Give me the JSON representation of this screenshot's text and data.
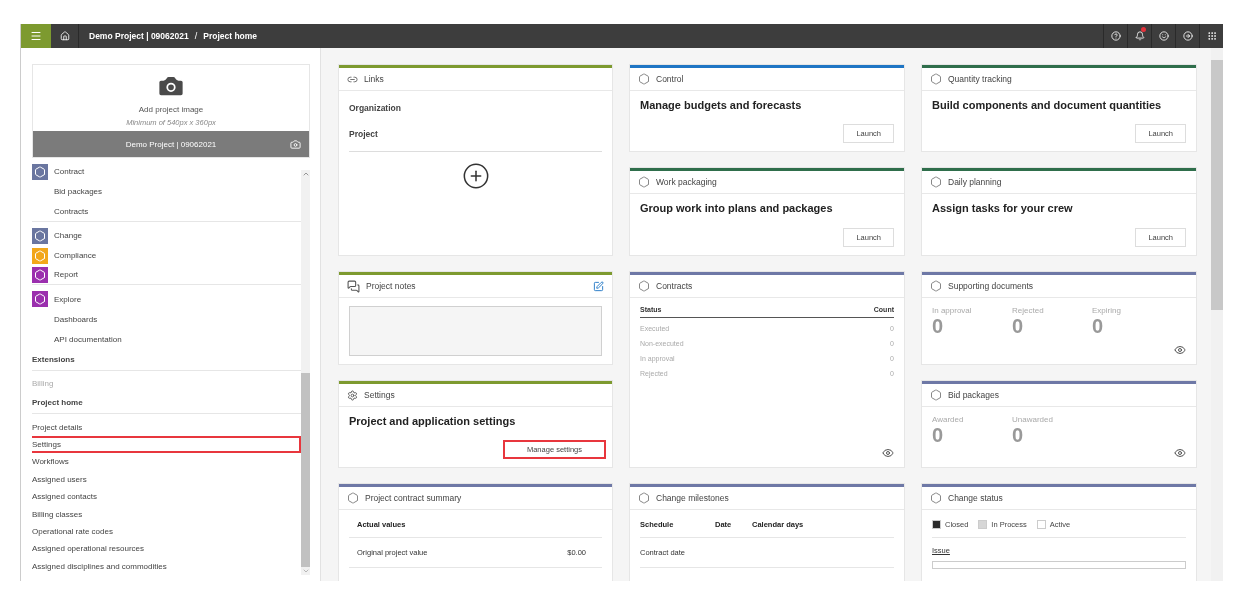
{
  "topbar": {
    "separator": "/",
    "breadcrumb": [
      {
        "label": "Demo Project | 09062021"
      },
      {
        "label": "Project home"
      }
    ],
    "notification_badge": true
  },
  "sidebar": {
    "image_panel": {
      "title": "Add project image",
      "hint": "Minimum of 540px x 360px",
      "project_name": "Demo Project | 09062021"
    },
    "items": [
      {
        "kind": "app",
        "label": "Contract",
        "color": "#6a76a0",
        "divider": false,
        "disabled": false,
        "highlighted": false
      },
      {
        "kind": "sub",
        "label": "Bid packages",
        "divider": false,
        "disabled": false,
        "highlighted": false
      },
      {
        "kind": "sub",
        "label": "Contracts",
        "divider": true,
        "disabled": false,
        "highlighted": false
      },
      {
        "kind": "app",
        "label": "Change",
        "color": "#6a76a0",
        "divider": false,
        "disabled": false,
        "highlighted": false
      },
      {
        "kind": "app",
        "label": "Compliance",
        "color": "#f2a71b",
        "divider": false,
        "disabled": false,
        "highlighted": false
      },
      {
        "kind": "app",
        "label": "Report",
        "color": "#9b2fae",
        "divider": true,
        "disabled": false,
        "highlighted": false
      },
      {
        "kind": "app",
        "label": "Explore",
        "color": "#9b2fae",
        "divider": false,
        "disabled": false,
        "highlighted": false
      },
      {
        "kind": "sub",
        "label": "Dashboards",
        "divider": false,
        "disabled": false,
        "highlighted": false
      },
      {
        "kind": "sub",
        "label": "API documentation",
        "divider": false,
        "disabled": false,
        "highlighted": false
      },
      {
        "kind": "heading",
        "label": "Extensions",
        "divider": true,
        "disabled": false,
        "highlighted": false
      },
      {
        "kind": "plain",
        "label": "Billing",
        "divider": false,
        "disabled": true,
        "highlighted": false
      },
      {
        "kind": "heading",
        "label": "Project home",
        "divider": true,
        "disabled": false,
        "highlighted": false
      },
      {
        "kind": "plain",
        "label": "Project details",
        "divider": false,
        "disabled": false,
        "highlighted": false
      },
      {
        "kind": "plain",
        "label": "Settings",
        "divider": false,
        "disabled": false,
        "highlighted": true
      },
      {
        "kind": "plain",
        "label": "Workflows",
        "divider": false,
        "disabled": false,
        "highlighted": false
      },
      {
        "kind": "plain",
        "label": "Assigned users",
        "divider": false,
        "disabled": false,
        "highlighted": false
      },
      {
        "kind": "plain",
        "label": "Assigned contacts",
        "divider": false,
        "disabled": false,
        "highlighted": false
      },
      {
        "kind": "plain",
        "label": "Billing classes",
        "divider": false,
        "disabled": false,
        "highlighted": false
      },
      {
        "kind": "plain",
        "label": "Operational rate codes",
        "divider": false,
        "disabled": false,
        "highlighted": false
      },
      {
        "kind": "plain",
        "label": "Assigned operational resources",
        "divider": false,
        "disabled": false,
        "highlighted": false
      },
      {
        "kind": "plain",
        "label": "Assigned disciplines and commodities",
        "divider": false,
        "disabled": false,
        "highlighted": false
      }
    ]
  },
  "cards": [
    {
      "kind": "links",
      "title": "Links",
      "color": "#7d9a2f",
      "rows": [
        "Organization",
        "Project"
      ]
    },
    {
      "kind": "launch",
      "title": "Control",
      "color": "#1f75c4",
      "heading": "Manage budgets and forecasts",
      "button": "Launch"
    },
    {
      "kind": "launch",
      "title": "Quantity tracking",
      "color": "#2f6e4b",
      "heading": "Build components and document quantities",
      "button": "Launch"
    },
    {
      "kind": "launch",
      "title": "Work packaging",
      "color": "#2f6e4b",
      "heading": "Group work into plans and packages",
      "button": "Launch"
    },
    {
      "kind": "launch",
      "title": "Daily planning",
      "color": "#2f6e4b",
      "heading": "Assign tasks for your crew",
      "button": "Launch"
    },
    {
      "kind": "notes",
      "title": "Project notes",
      "color": "#7d9a2f"
    },
    {
      "kind": "table",
      "title": "Contracts",
      "color": "#6e78a6",
      "columns": [
        "Status",
        "Count"
      ],
      "rows": [
        [
          "Executed",
          "0"
        ],
        [
          "Non-executed",
          "0"
        ],
        [
          "In approval",
          "0"
        ],
        [
          "Rejected",
          "0"
        ]
      ]
    },
    {
      "kind": "stats",
      "title": "Supporting documents",
      "color": "#6e78a6",
      "stats": [
        {
          "label": "In approval",
          "value": "0"
        },
        {
          "label": "Rejected",
          "value": "0"
        },
        {
          "label": "Expiring",
          "value": "0"
        }
      ]
    },
    {
      "kind": "settings",
      "title": "Settings",
      "color": "#7d9a2f",
      "heading": "Project and application settings",
      "button": "Manage settings",
      "highlighted": true
    },
    {
      "kind": "stats",
      "title": "Bid packages",
      "color": "#6e78a6",
      "stats": [
        {
          "label": "Awarded",
          "value": "0"
        },
        {
          "label": "Unawarded",
          "value": "0"
        }
      ]
    },
    {
      "kind": "summary",
      "title": "Project contract summary",
      "color": "#6e78a6",
      "header": "Actual values",
      "rows": [
        [
          "Original project value",
          "$0.00"
        ]
      ]
    },
    {
      "kind": "milestones",
      "title": "Change milestones",
      "color": "#6e78a6",
      "columns": [
        "Schedule",
        "Date",
        "Calendar days"
      ],
      "rows": [
        "Contract date"
      ]
    },
    {
      "kind": "status",
      "title": "Change status",
      "color": "#6e78a6",
      "legend": [
        {
          "label": "Closed",
          "color": "#2b2b2b"
        },
        {
          "label": "In Process",
          "color": "#d6d6d6"
        },
        {
          "label": "Active",
          "color": "#ffffff"
        }
      ],
      "link": "Issue"
    }
  ]
}
